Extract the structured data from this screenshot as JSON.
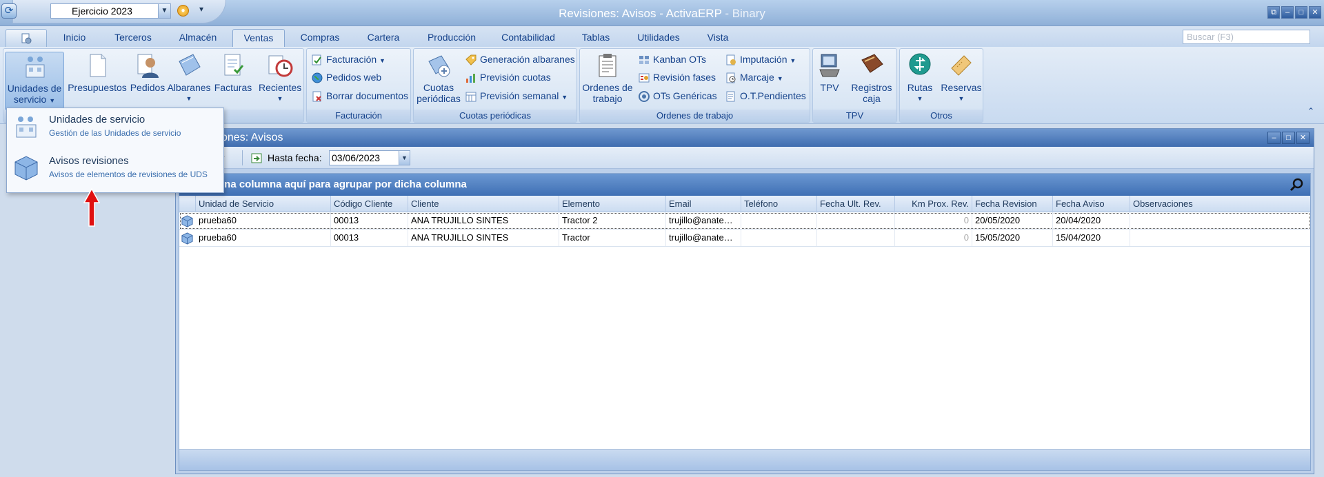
{
  "window": {
    "title_main": "Revisiones: Avisos - ActivaERP",
    "title_sub": " - Binary"
  },
  "qat": {
    "year_value": "Ejercicio 2023"
  },
  "tabs": [
    {
      "label": "Inicio"
    },
    {
      "label": "Terceros"
    },
    {
      "label": "Almacén"
    },
    {
      "label": "Ventas"
    },
    {
      "label": "Compras"
    },
    {
      "label": "Cartera"
    },
    {
      "label": "Producción"
    },
    {
      "label": "Contabilidad"
    },
    {
      "label": "Tablas"
    },
    {
      "label": "Utilidades"
    },
    {
      "label": "Vista"
    }
  ],
  "search": {
    "placeholder": "Buscar (F3)"
  },
  "ribbon": {
    "unidades_line1": "Unidades de",
    "unidades_line2": "servicio",
    "presupuestos": "Presupuestos",
    "pedidos": "Pedidos",
    "albaranes": "Albaranes",
    "facturas": "Facturas",
    "recientes": "Recientes",
    "facturacion_menu": "Facturación",
    "pedidos_web": "Pedidos web",
    "borrar_documentos": "Borrar documentos",
    "group_facturacion": "Facturación",
    "cuotas_line1": "Cuotas",
    "cuotas_line2": "periódicas",
    "generacion_albaranes": "Generación albaranes",
    "prevision_cuotas": "Previsión cuotas",
    "prevision_semanal": "Previsión semanal",
    "group_cuotas": "Cuotas periódicas",
    "ordenes_line1": "Ordenes de",
    "ordenes_line2": "trabajo",
    "kanban_ots": "Kanban OTs",
    "revision_fases": "Revisión fases",
    "ots_genericas": "OTs Genéricas",
    "imputacion": "Imputación",
    "marcaje": "Marcaje",
    "ot_pendientes": "O.T.Pendientes",
    "group_ordenes": "Ordenes de trabajo",
    "tpv": "TPV",
    "registros_line1": "Registros",
    "registros_line2": "caja",
    "group_tpv": "TPV",
    "rutas": "Rutas",
    "reservas": "Reservas",
    "group_otros": "Otros"
  },
  "menu": {
    "items": [
      {
        "title": "Unidades de servicio",
        "desc": "Gestión de las Unidades de servicio"
      },
      {
        "title": "Avisos revisiones",
        "desc": "Avisos de elementos de revisiones de UDS"
      }
    ]
  },
  "doc": {
    "title": "Revisiones: Avisos",
    "title_visible": "ones: Avisos",
    "prev_label_visible": "ar",
    "hasta_fecha_label": "Hasta fecha:",
    "hasta_fecha_value": "03/06/2023",
    "groupbar_visible": "una columna aquí para agrupar por dicha columna"
  },
  "grid": {
    "columns": [
      "Unidad de Servicio",
      "Código Cliente",
      "Cliente",
      "Elemento",
      "Email",
      "Teléfono",
      "Fecha Ult. Rev.",
      "Km Prox. Rev.",
      "Fecha Revision",
      "Fecha Aviso",
      "Observaciones"
    ],
    "rows": [
      [
        "prueba60",
        "00013",
        "ANA TRUJILLO SINTES",
        "Tractor 2",
        "trujillo@anate…",
        "",
        "",
        "0",
        "20/05/2020",
        "20/04/2020",
        ""
      ],
      [
        "prueba60",
        "00013",
        "ANA TRUJILLO SINTES",
        "Tractor",
        "trujillo@anate…",
        "",
        "",
        "0",
        "15/05/2020",
        "15/04/2020",
        ""
      ]
    ]
  },
  "colors": {
    "accent": "#15428b",
    "titlebar": "#8fb0d8",
    "grid_header": "#3f6fb4"
  }
}
